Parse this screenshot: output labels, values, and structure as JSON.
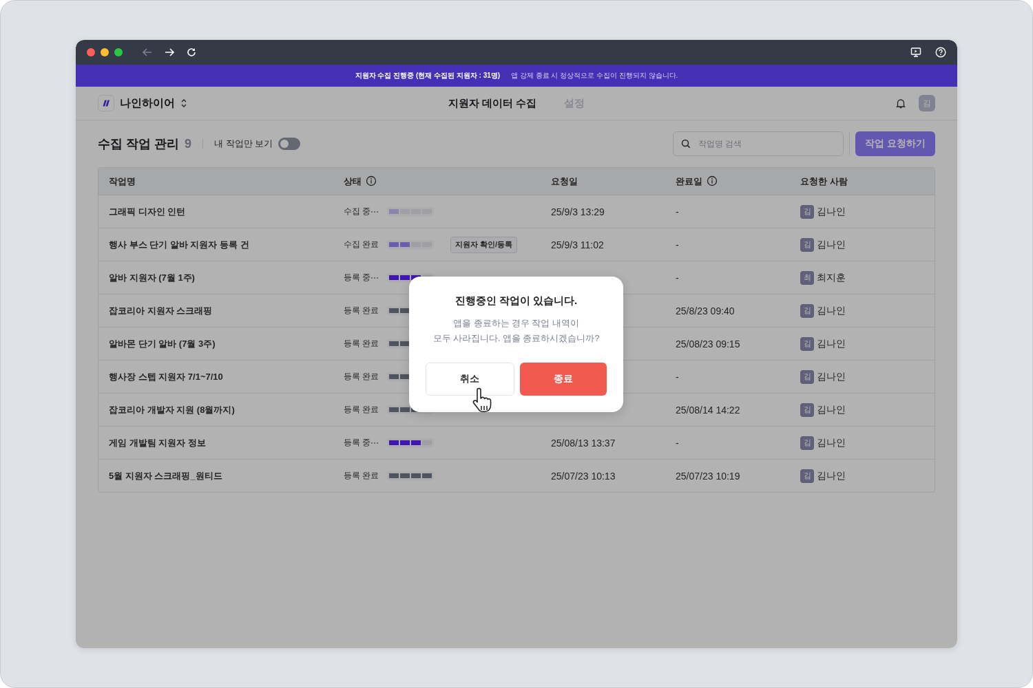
{
  "browser": {
    "back_disabled": true
  },
  "banner": {
    "status": "지원자 수집 진행중 (현재 수집된 지원자 : 31명)",
    "message": "앱 강제 종료 시 정상적으로 수집이 진행되지 않습니다."
  },
  "nav": {
    "workspace": "나인하이어",
    "tabs": [
      {
        "label": "지원자 데이터 수집",
        "selected": true
      },
      {
        "label": "설정",
        "selected": false
      }
    ],
    "avatar": "김"
  },
  "toolbar": {
    "title": "수집 작업 관리",
    "count": "9",
    "filter_label": "내 작업만 보기",
    "filter_on": false,
    "search": {
      "placeholder": "작업명 검색"
    },
    "request_button": {
      "label": "작업 요청하기",
      "disabled": true
    }
  },
  "table": {
    "columns": [
      {
        "label": "작업명",
        "kind": "plain"
      },
      {
        "label": "상태",
        "kind": "info"
      },
      {
        "label": "요청일",
        "kind": "plain"
      },
      {
        "label": "완료일",
        "kind": "info"
      },
      {
        "label": "요청한 사람",
        "kind": "plain"
      }
    ],
    "rows": [
      {
        "name": "그래픽 디자인 인턴",
        "status": {
          "label": "수집 중",
          "kind": "collecting",
          "in_progress": true
        },
        "level": 0.25,
        "requested": "25/9/3 13:29",
        "completed": "-",
        "requester": {
          "initial": "김",
          "name": "김나인"
        }
      },
      {
        "name": "행사 부스 단기 알바 지원자 등록 건",
        "status": {
          "label": "수집 완료",
          "kind": "collected",
          "in_progress": false
        },
        "level": 0.5,
        "action": "지원자 확인/등록",
        "requested": "25/9/3 11:02",
        "completed": "-",
        "requester": {
          "initial": "김",
          "name": "김나인"
        }
      },
      {
        "name": "알바 지원자 (7월 1주)",
        "status": {
          "label": "등록 중",
          "kind": "registering",
          "in_progress": true
        },
        "level": 0.75,
        "completed": "-",
        "requester": {
          "initial": "최",
          "name": "최지훈"
        }
      },
      {
        "name": "잡코리아 지원자 스크래핑",
        "status": {
          "label": "등록 완료",
          "kind": "registered",
          "in_progress": false
        },
        "level": 1,
        "completed": "25/8/23 09:40",
        "requester": {
          "initial": "김",
          "name": "김나인"
        }
      },
      {
        "name": "알바몬 단기 알바 (7월 3주)",
        "status": {
          "label": "등록 완료",
          "kind": "registered",
          "in_progress": false
        },
        "level": 1,
        "completed": "25/08/23 09:15",
        "requester": {
          "initial": "김",
          "name": "김나인"
        }
      },
      {
        "name": "행사장 스텝 지원자 7/1~7/10",
        "status": {
          "label": "등록 완료",
          "kind": "registered",
          "in_progress": false
        },
        "level": 1,
        "completed": "-",
        "requester": {
          "initial": "김",
          "name": "김나인"
        }
      },
      {
        "name": "잡코리아 개발자 지원 (8월까지)",
        "status": {
          "label": "등록 완료",
          "kind": "registered",
          "in_progress": false
        },
        "level": 1,
        "completed": "25/08/14 14:22",
        "requester": {
          "initial": "김",
          "name": "김나인"
        }
      },
      {
        "name": "게임 개발팀 지원자 정보",
        "status": {
          "label": "등록 중",
          "kind": "registering",
          "in_progress": true
        },
        "level": 0.75,
        "requested": "25/08/13 13:37",
        "completed": "-",
        "requester": {
          "initial": "김",
          "name": "김나인"
        }
      },
      {
        "name": "5월 지원자 스크래핑_원티드",
        "status": {
          "label": "등록 완료",
          "kind": "registered",
          "in_progress": false
        },
        "level": 1,
        "requested": "25/07/23 10:13",
        "completed": "25/07/23 10:19",
        "requester": {
          "initial": "김",
          "name": "김나인"
        }
      }
    ]
  },
  "dialog": {
    "title": "진행중인 작업이 있습니다.",
    "message_lines": [
      "앱을 종료하는 경우 작업 내역이",
      "모두 사라집니다. 앱을 종료하시겠습니까?"
    ],
    "cancel": "취소",
    "confirm": "종료"
  }
}
